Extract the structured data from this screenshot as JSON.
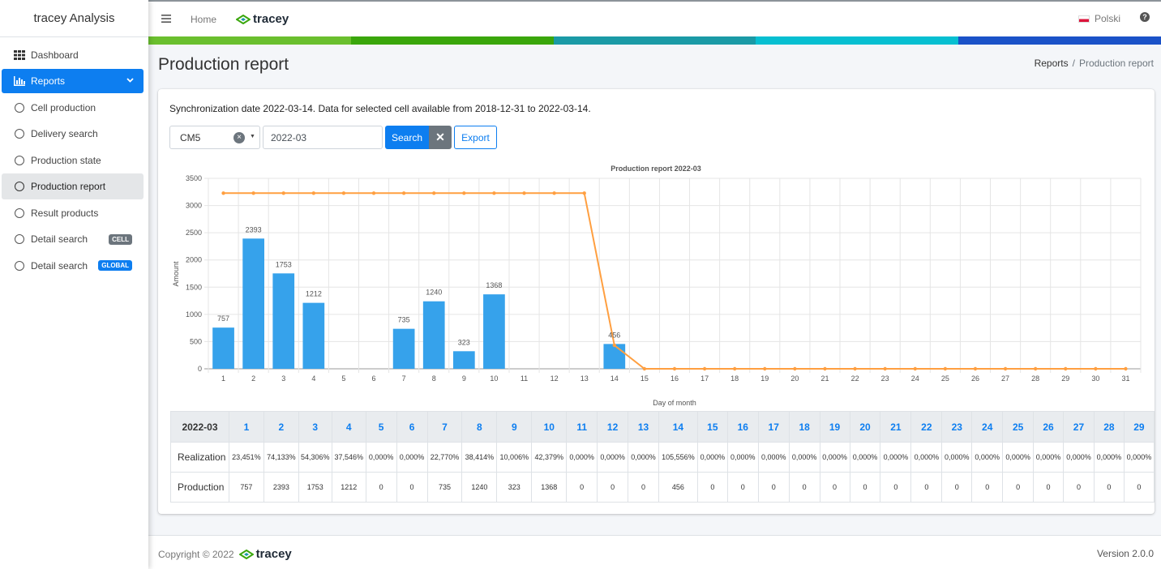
{
  "app": {
    "title": "tracey Analysis",
    "logo_text": "tracey"
  },
  "sidebar": {
    "items": [
      {
        "label": "Dashboard"
      },
      {
        "label": "Reports"
      },
      {
        "label": "Cell production"
      },
      {
        "label": "Delivery search"
      },
      {
        "label": "Production state"
      },
      {
        "label": "Production report"
      },
      {
        "label": "Result products"
      },
      {
        "label": "Detail search",
        "badge": "CELL"
      },
      {
        "label": "Detail search",
        "badge": "GLOBAL"
      }
    ]
  },
  "topbar": {
    "home": "Home",
    "language": "Polski",
    "help": "?"
  },
  "colors": {
    "stripe": [
      "#6abf2e",
      "#3aa60b",
      "#1a9aa6",
      "#07bfd1",
      "#1a52c8"
    ],
    "primary": "#0d7ef0",
    "bar": "#36a2eb",
    "line": "#ff9f40"
  },
  "page": {
    "title": "Production report",
    "breadcrumb": {
      "root": "Reports",
      "separator": "/",
      "current": "Production report"
    }
  },
  "report": {
    "sync_text": "Synchronization date 2022-03-14. Data for selected cell available from 2018-12-31 to 2022-03-14.",
    "cell": "CM5",
    "date": "2022-03",
    "search_label": "Search",
    "export_label": "Export"
  },
  "chart_data": {
    "type": "bar",
    "title": "Production report 2022-03",
    "xlabel": "Day of month",
    "ylabel": "Amount",
    "ylim": [
      0,
      3500
    ],
    "yticks": [
      0,
      500,
      1000,
      1500,
      2000,
      2500,
      3000,
      3500
    ],
    "categories": [
      "1",
      "2",
      "3",
      "4",
      "5",
      "6",
      "7",
      "8",
      "9",
      "10",
      "11",
      "12",
      "13",
      "14",
      "15",
      "16",
      "17",
      "18",
      "19",
      "20",
      "21",
      "22",
      "23",
      "24",
      "25",
      "26",
      "27",
      "28",
      "29",
      "30",
      "31"
    ],
    "series": [
      {
        "type": "bar",
        "values": [
          757,
          2393,
          1753,
          1212,
          0,
          0,
          735,
          1240,
          323,
          1368,
          0,
          0,
          0,
          456,
          0,
          0,
          0,
          0,
          0,
          0,
          0,
          0,
          0,
          0,
          0,
          0,
          0,
          0,
          0,
          0,
          0
        ]
      },
      {
        "type": "line",
        "values": [
          3228,
          3228,
          3228,
          3228,
          3228,
          3228,
          3228,
          3228,
          3228,
          3228,
          3228,
          3228,
          3228,
          432,
          0,
          0,
          0,
          0,
          0,
          0,
          0,
          0,
          0,
          0,
          0,
          0,
          0,
          0,
          0,
          0,
          0
        ]
      }
    ],
    "grid": true
  },
  "table": {
    "corner": "2022-03",
    "days": [
      "1",
      "2",
      "3",
      "4",
      "5",
      "6",
      "7",
      "8",
      "9",
      "10",
      "11",
      "12",
      "13",
      "14",
      "15",
      "16",
      "17",
      "18",
      "19",
      "20",
      "21",
      "22",
      "23",
      "24",
      "25",
      "26",
      "27",
      "28",
      "29"
    ],
    "rows": [
      {
        "label": "Realization",
        "values": [
          "23,451%",
          "74,133%",
          "54,306%",
          "37,546%",
          "0,000%",
          "0,000%",
          "22,770%",
          "38,414%",
          "10,006%",
          "42,379%",
          "0,000%",
          "0,000%",
          "0,000%",
          "105,556%",
          "0,000%",
          "0,000%",
          "0,000%",
          "0,000%",
          "0,000%",
          "0,000%",
          "0,000%",
          "0,000%",
          "0,000%",
          "0,000%",
          "0,000%",
          "0,000%",
          "0,000%",
          "0,000%",
          "0,000%"
        ]
      },
      {
        "label": "Production",
        "values": [
          "757",
          "2393",
          "1753",
          "1212",
          "0",
          "0",
          "735",
          "1240",
          "323",
          "1368",
          "0",
          "0",
          "0",
          "456",
          "0",
          "0",
          "0",
          "0",
          "0",
          "0",
          "0",
          "0",
          "0",
          "0",
          "0",
          "0",
          "0",
          "0",
          "0"
        ]
      }
    ]
  },
  "footer": {
    "copyright": "Copyright © 2022",
    "version": "Version 2.0.0"
  }
}
